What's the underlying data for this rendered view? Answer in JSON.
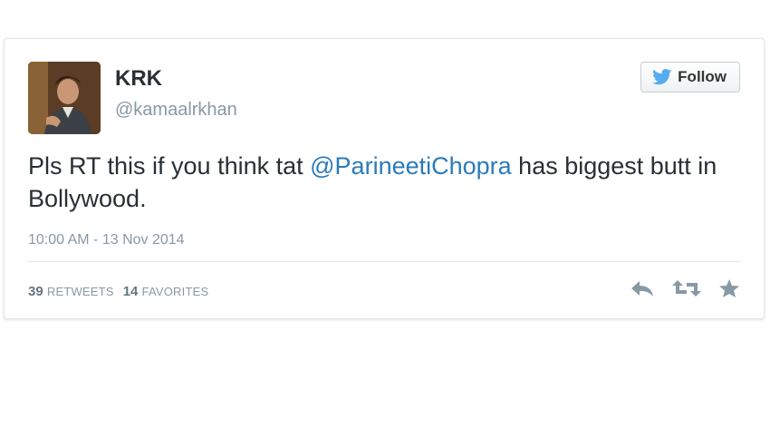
{
  "tweet": {
    "user": {
      "name": "KRK",
      "handle": "@kamaalrkhan"
    },
    "follow_label": "Follow",
    "text": {
      "before": "Pls RT this if you think tat ",
      "mention": "@ParineetiChopra",
      "after": " has biggest butt in Bollywood."
    },
    "timestamp": "10:00 AM - 13 Nov 2014",
    "stats": {
      "retweets_count": "39",
      "retweets_label": "RETWEETS",
      "favorites_count": "14",
      "favorites_label": "FAVORITES"
    },
    "icons": [
      "twitter-bird-icon",
      "reply-icon",
      "retweet-icon",
      "favorite-star-icon"
    ],
    "colors": {
      "mention": "#2b7bb9",
      "muted": "#8899a6",
      "bird": "#55acee"
    }
  }
}
